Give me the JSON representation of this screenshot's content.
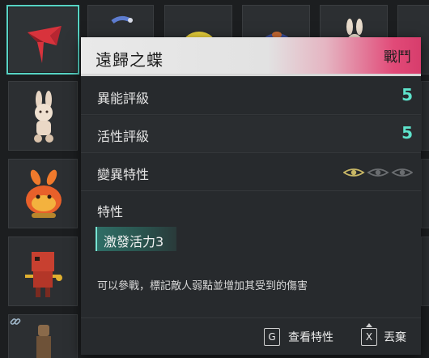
{
  "item": {
    "name": "遠歸之蝶",
    "type": "戰鬥",
    "ability_rating_label": "異能評級",
    "ability_rating_value": "5",
    "activity_rating_label": "活性評級",
    "activity_rating_value": "5",
    "mutation_label": "變異特性",
    "mutation_level": 1,
    "mutation_max": 3,
    "traits_label": "特性",
    "trait": "激發活力3",
    "description": "可以參戰，標記敵人弱點並增加其受到的傷害"
  },
  "actions": {
    "view_key": "G",
    "view_label": "查看特性",
    "discard_key": "X",
    "discard_label": "丟棄"
  },
  "colors": {
    "selected_border": "#57d3c4",
    "rating_value": "#5ee3cb",
    "header_accent": "#e14a78",
    "eye_active": "#c9b866",
    "eye_inactive": "#6a6d70"
  }
}
